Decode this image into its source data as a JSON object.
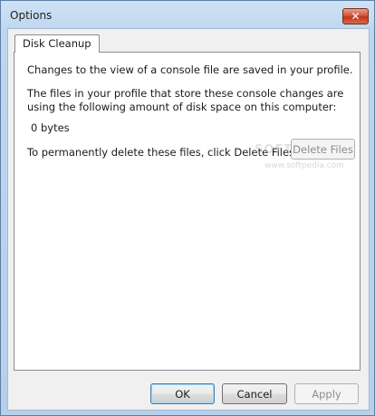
{
  "window": {
    "title": "Options",
    "close_glyph": "✕"
  },
  "tabs": [
    {
      "label": "Disk Cleanup",
      "selected": true
    }
  ],
  "content": {
    "intro": "Changes to the view of a console file are saved in your profile.",
    "description": "The files in your profile that store these console changes are using the following amount of disk space on this computer:",
    "size": "0 bytes",
    "delete_hint": "To permanently delete these files, click Delete Files.",
    "delete_button": "Delete Files"
  },
  "buttons": {
    "ok": "OK",
    "cancel": "Cancel",
    "apply": "Apply"
  },
  "watermark": {
    "brand": "SOFTPEDIA",
    "url": "www.softpedia.com"
  },
  "colors": {
    "title_bar": "#bcd6ef",
    "close_button": "#c2361b",
    "client_bg": "#f0f0f0",
    "panel_bg": "#ffffff"
  }
}
